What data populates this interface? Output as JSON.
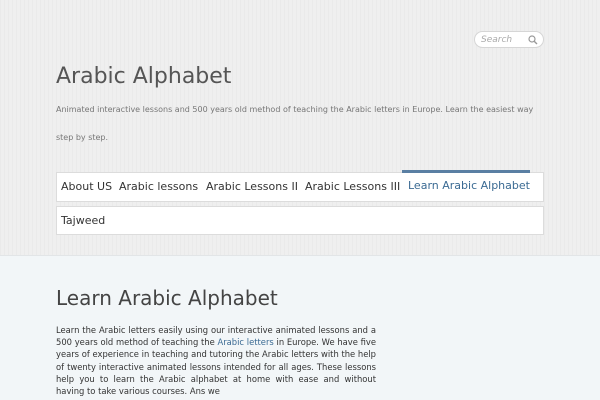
{
  "search": {
    "placeholder": "Search"
  },
  "site": {
    "title": "Arabic Alphabet",
    "tagline": "Animated interactive lessons and 500 years old method of teaching the Arabic letters in Europe. Learn the easiest way step by step."
  },
  "nav": {
    "items": [
      {
        "label": "About US"
      },
      {
        "label": "Arabic lessons"
      },
      {
        "label": "Arabic Lessons II"
      },
      {
        "label": "Arabic Lessons III"
      },
      {
        "label": "Learn Arabic Alphabet"
      },
      {
        "label": "Tajweed"
      }
    ],
    "active_index": 4
  },
  "page": {
    "title": "Learn Arabic Alphabet",
    "body_before_link": "Learn the Arabic letters easily using our interactive animated lessons and a 500 years old method of teaching the ",
    "body_link": "Arabic letters",
    "body_after_link": " in Europe. We have five years of experience in teaching and tutoring the Arabic letters with the help of twenty interactive animated lessons intended for all ages. These lessons help you to learn the Arabic alphabet at home with ease and without having to take various courses. Ans we"
  },
  "colors": {
    "link": "#3a6a93",
    "active_border": "#5a7fa3"
  }
}
